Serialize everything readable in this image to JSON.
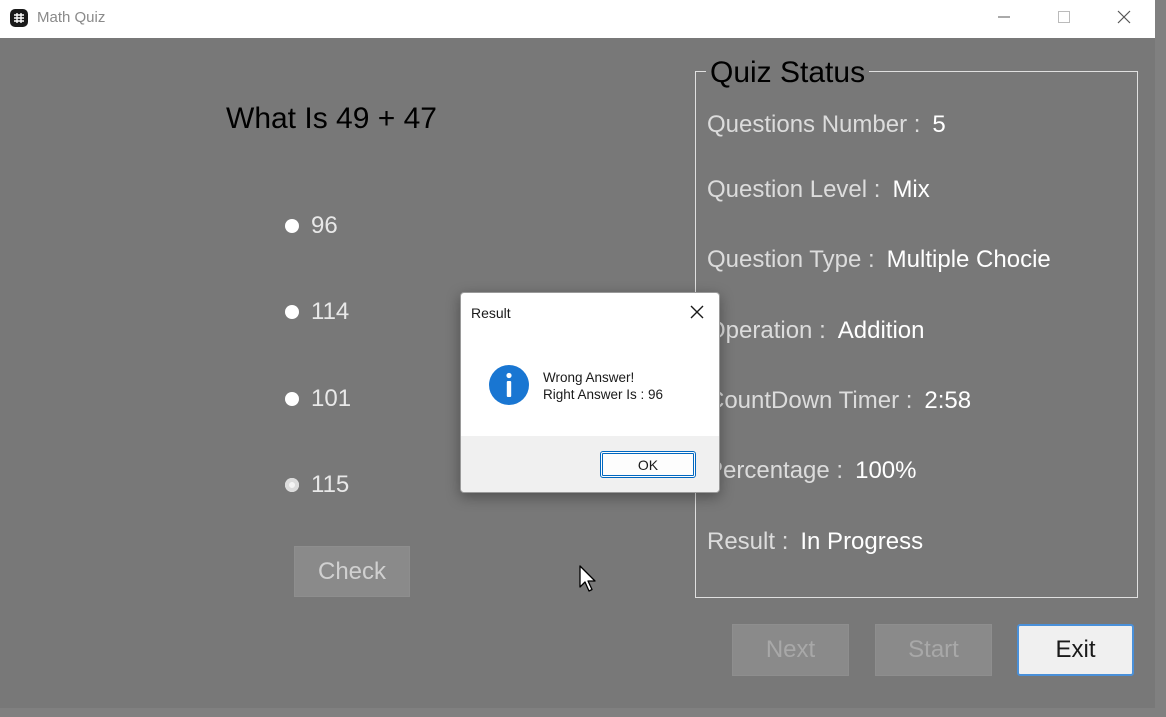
{
  "window": {
    "title": "Math Quiz",
    "controls": {
      "minimize": "minimize-icon",
      "maximize": "maximize-icon",
      "close": "close-icon"
    }
  },
  "quiz": {
    "question": "What Is 49 + 47",
    "options": [
      {
        "label": "96",
        "selected": false
      },
      {
        "label": "114",
        "selected": false
      },
      {
        "label": "101",
        "selected": false
      },
      {
        "label": "115",
        "selected": true
      }
    ],
    "check_label": "Check"
  },
  "status": {
    "title": "Quiz Status",
    "rows": [
      {
        "label": "Questions Number :",
        "value": "5"
      },
      {
        "label": "Question Level :",
        "value": "Mix"
      },
      {
        "label": "Question Type :",
        "value": "Multiple Chocie"
      },
      {
        "label": "Operation :",
        "value": "Addition"
      },
      {
        "label": "CountDown Timer :",
        "value": "2:58"
      },
      {
        "label": "Percentage :",
        "value": "100%"
      },
      {
        "label": "Result :",
        "value": "In Progress"
      }
    ]
  },
  "buttons": {
    "next": "Next",
    "start": "Start",
    "exit": "Exit"
  },
  "dialog": {
    "title": "Result",
    "line1": "Wrong Answer!",
    "line2": "Right Answer Is : 96",
    "ok": "OK",
    "icon": "info-icon"
  },
  "colors": {
    "background": "#787878",
    "accent": "#0067c0",
    "info": "#1976d2"
  }
}
